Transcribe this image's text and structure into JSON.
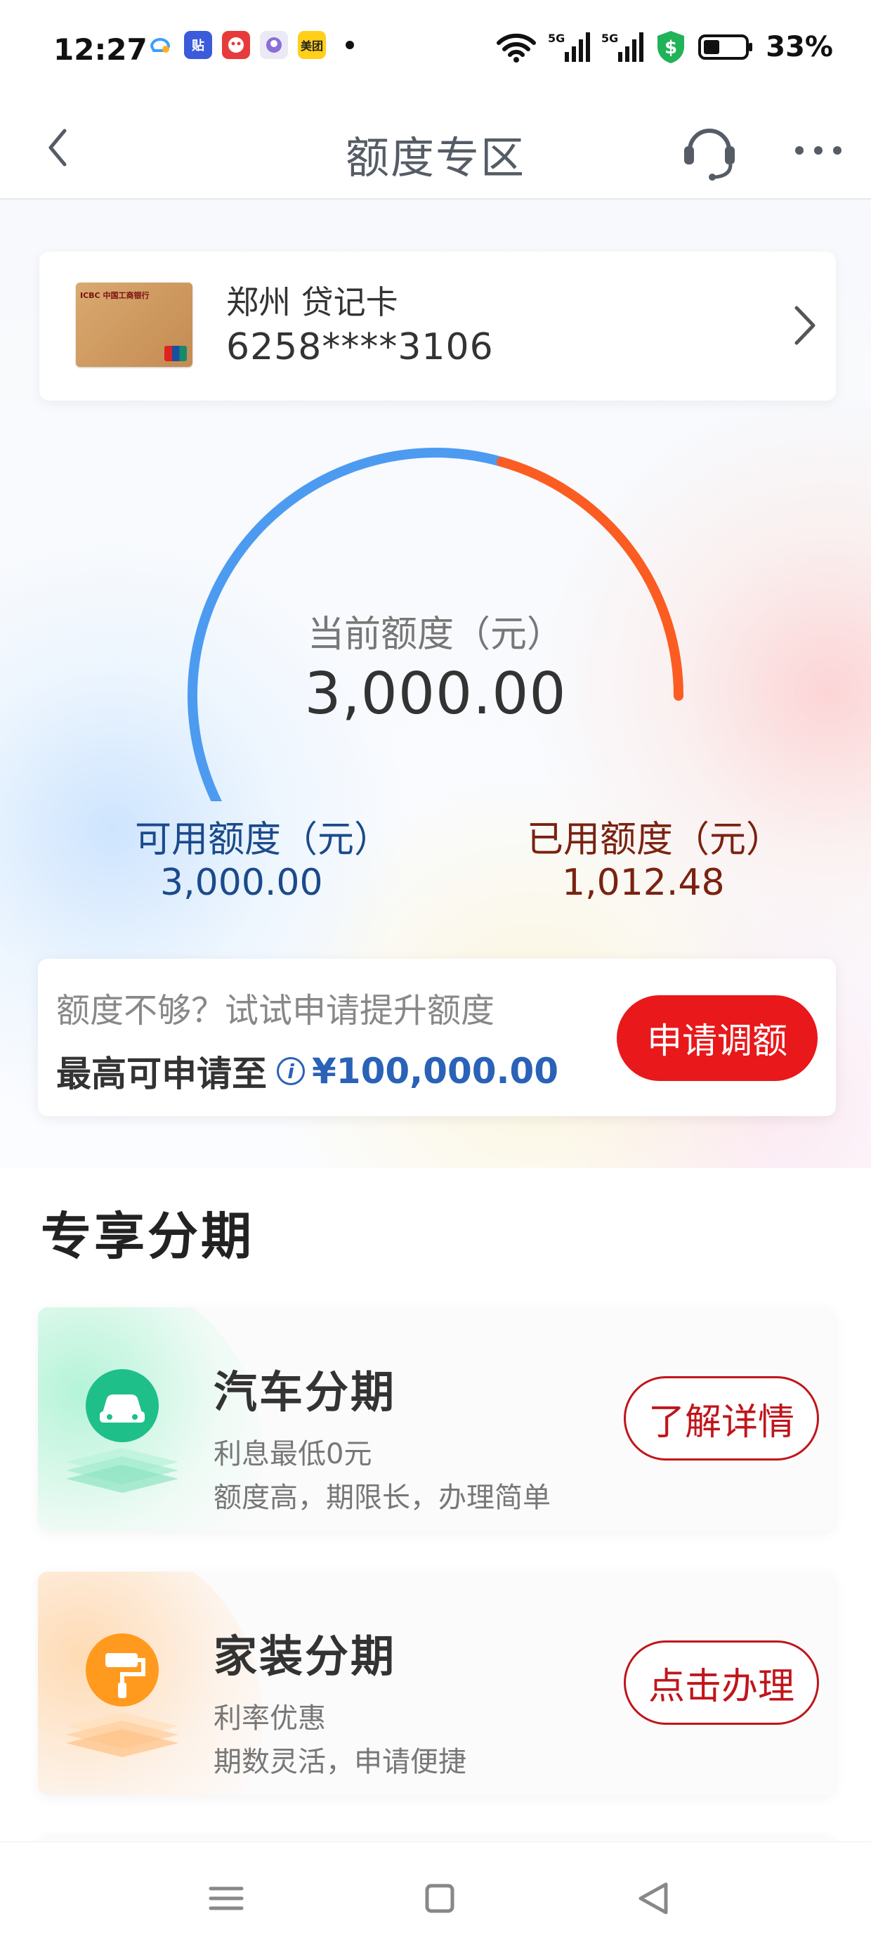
{
  "status_bar": {
    "time": "12:27",
    "apps": [
      {
        "name": "qq-icon",
        "color": "#3aa0ff",
        "text": ""
      },
      {
        "name": "tieba-icon",
        "color": "#3b5bdb",
        "text": "贴"
      },
      {
        "name": "xiaohongshu-icon",
        "color": "#e73b3b",
        "text": ""
      },
      {
        "name": "app-icon",
        "color": "#8a6fd8",
        "text": ""
      },
      {
        "name": "meituan-icon",
        "color": "#ffcf1a",
        "text": "美团"
      }
    ],
    "battery_percent": "33%"
  },
  "nav": {
    "title": "额度专区"
  },
  "card": {
    "name": "郑州 贷记卡",
    "number": "6258****3106"
  },
  "gauge": {
    "label": "当前额度（元）",
    "value": "3,000.00",
    "available_label": "可用额度（元）",
    "available_value": "3,000.00",
    "used_label": "已用额度（元）",
    "used_value": "1,012.48",
    "used_fraction": 0.3375,
    "colors": {
      "available": "#4c9bf1",
      "used": "#fb5c22"
    }
  },
  "raise": {
    "hint": "额度不够？试试申请提升额度",
    "max_label": "最高可申请至",
    "max_amount": "¥100,000.00",
    "button": "申请调额"
  },
  "section": {
    "title": "专享分期"
  },
  "promos": [
    {
      "title": "汽车分期",
      "line1": "利息最低0元",
      "line2": "额度高，期限长，办理简单",
      "button": "了解详情",
      "icon": "car-icon",
      "color": "#1fbf8a"
    },
    {
      "title": "家装分期",
      "line1": "利率优惠",
      "line2": "期数灵活，申请便捷",
      "button": "点击办理",
      "icon": "paint-roller-icon",
      "color": "#ff9a1e"
    }
  ]
}
